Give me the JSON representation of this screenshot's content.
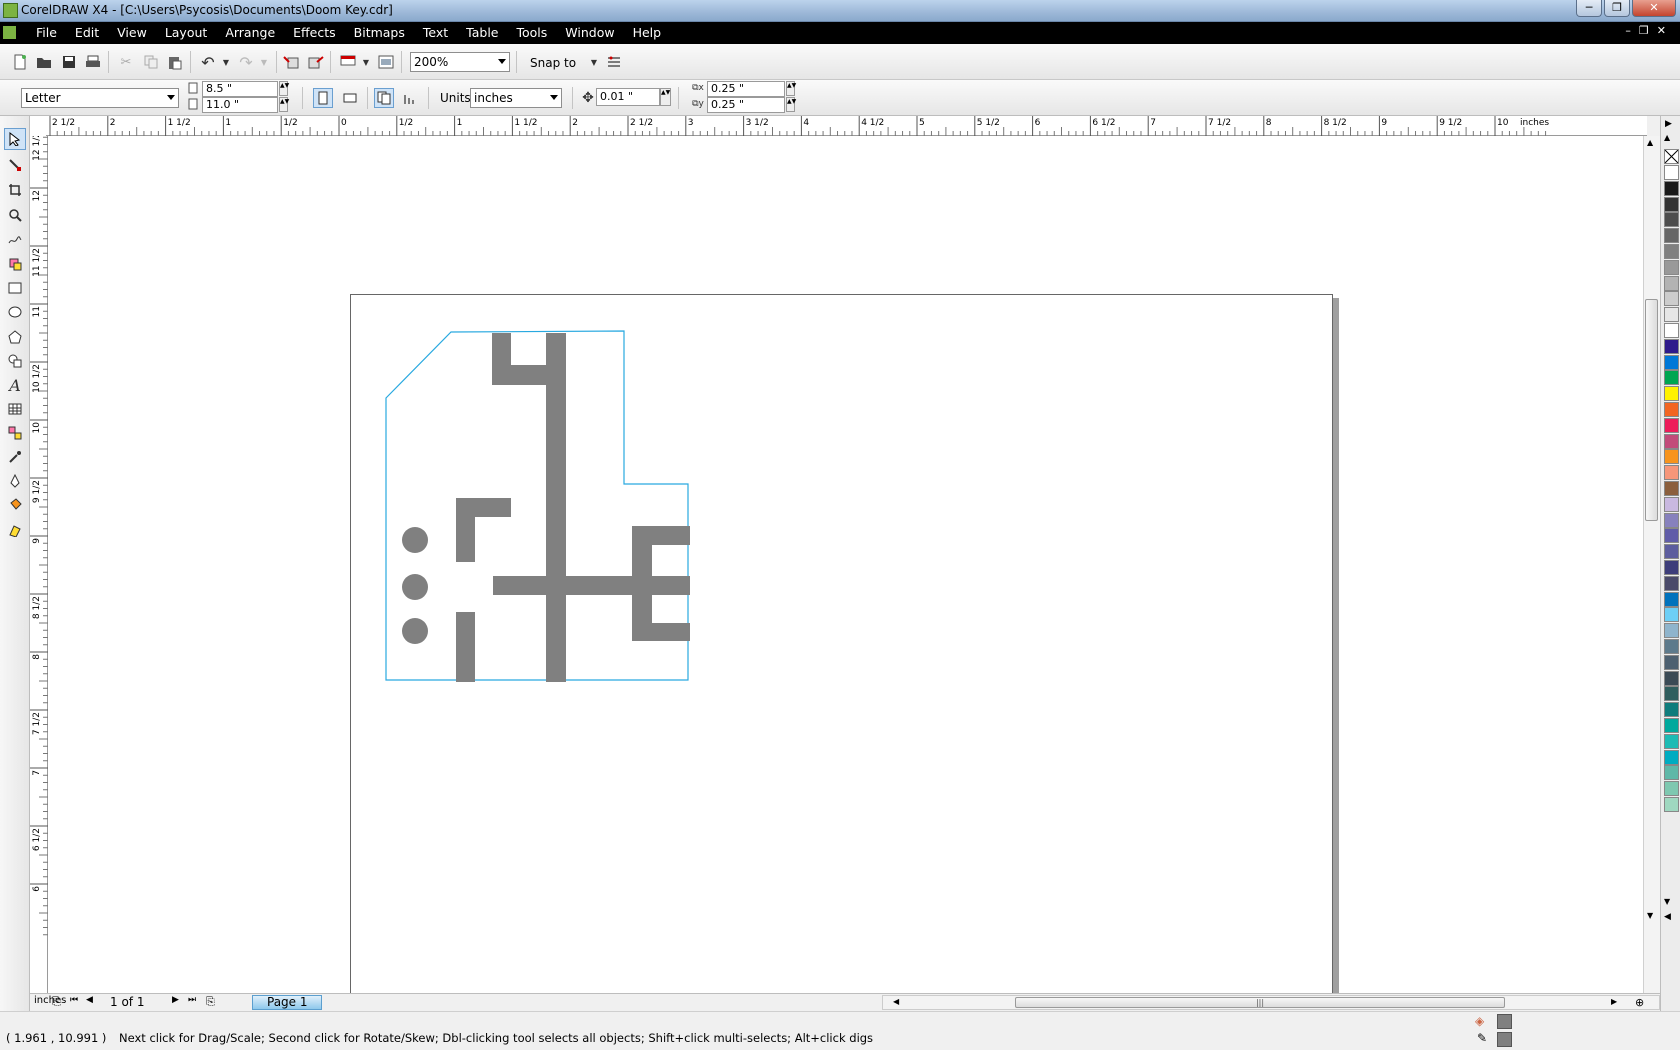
{
  "window": {
    "title": "CorelDRAW X4 - [C:\\Users\\Psycosis\\Documents\\Doom Key.cdr]",
    "buttons": [
      "─",
      "❐",
      "✕"
    ]
  },
  "menu": {
    "items": [
      "File",
      "Edit",
      "View",
      "Layout",
      "Arrange",
      "Effects",
      "Bitmaps",
      "Text",
      "Table",
      "Tools",
      "Window",
      "Help"
    ]
  },
  "toolbar1": {
    "zoom": "200%",
    "snap_to": "Snap to"
  },
  "toolbar2": {
    "paper_size": "Letter",
    "width": "8.5 \"",
    "height": "11.0 \"",
    "units_label": "Units:",
    "units": "inches",
    "nudge": "0.01 \"",
    "dup_x": "0.25 \"",
    "dup_y": "0.25 \""
  },
  "ruler": {
    "h_ticks": [
      "2 1/2",
      "2",
      "1 1/2",
      "1",
      "1/2",
      "0",
      "1/2",
      "1",
      "1 1/2",
      "2",
      "2 1/2",
      "3",
      "3 1/2",
      "4",
      "4 1/2",
      "5",
      "5 1/2",
      "6",
      "6 1/2",
      "7",
      "7 1/2",
      "8",
      "8 1/2",
      "9",
      "9 1/2",
      "10"
    ],
    "h_unit": "inches",
    "v_ticks": [
      "12 1/2",
      "12",
      "11 1/2",
      "11",
      "10 1/2",
      "10",
      "9 1/2",
      "9",
      "8 1/2",
      "8",
      "7 1/2",
      "7",
      "6 1/2",
      "6"
    ],
    "v_unit": "inches"
  },
  "page_nav": {
    "counter": "1 of 1",
    "tab": "Page 1"
  },
  "status": {
    "coords": "( 1.961 , 10.991 )",
    "message": "Next click for Drag/Scale; Second click for Rotate/Skew; Dbl-clicking tool selects all objects; Shift+click multi-selects; Alt+click digs"
  },
  "colors": {
    "shape_fill": "#808080",
    "outline": "#29a9e0",
    "page_shadow": "#a0a0a0"
  },
  "palette": [
    "#ffffff",
    "#1a1a1a",
    "#333333",
    "#4d4d4d",
    "#666666",
    "#808080",
    "#999999",
    "#b3b3b3",
    "#cccccc",
    "#e6e6e6",
    "#ffffff",
    "#2e1a8c",
    "#0078d7",
    "#00a651",
    "#fff200",
    "#f26522",
    "#ed1c5a",
    "#c24b7a",
    "#f7941d",
    "#f69679",
    "#8b5e3c",
    "#c9b8e0",
    "#8781bd",
    "#605ca8",
    "#5c5c9e",
    "#3d3d7a",
    "#4a4a6a",
    "#0072bc",
    "#6dcff6",
    "#8fb4cc",
    "#5d7a8c",
    "#4d6070",
    "#3a4a55",
    "#2f5e5e",
    "#0f7c7c",
    "#00a99d",
    "#1cbbb4",
    "#00acc1",
    "#5fb8a8",
    "#7ec8b0",
    "#9fd8c0"
  ]
}
